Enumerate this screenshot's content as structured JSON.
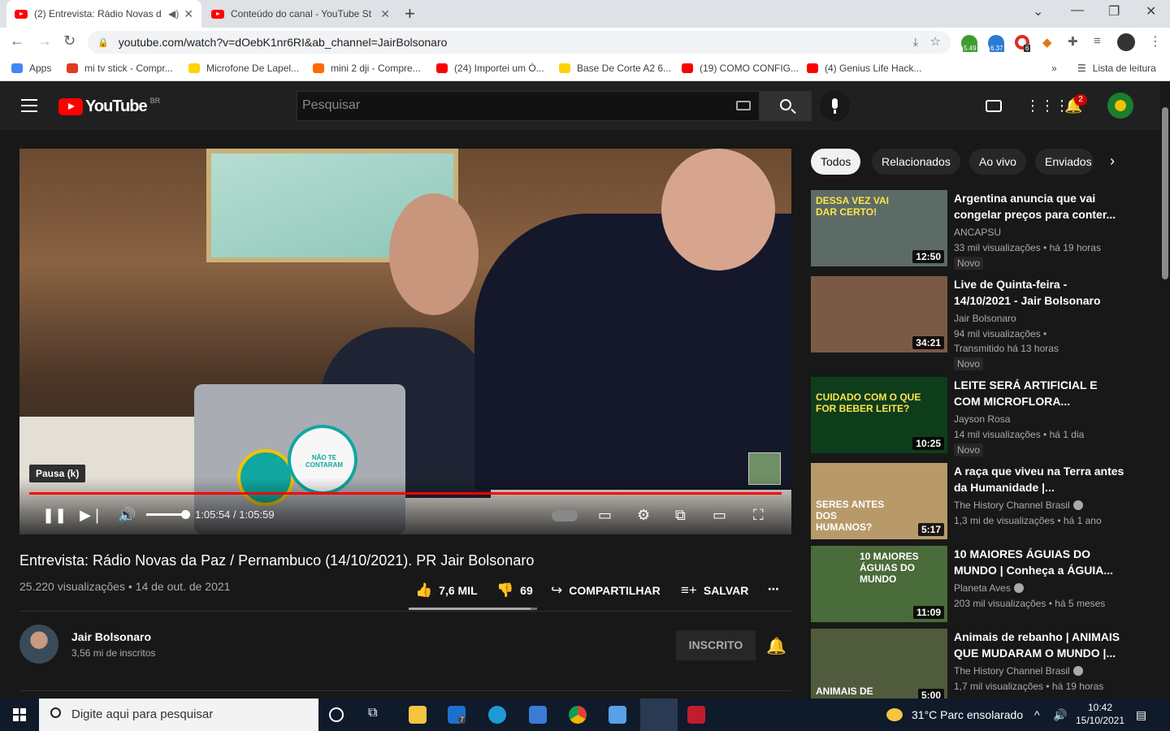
{
  "browser": {
    "tabs": [
      {
        "title": "(2) Entrevista: Rádio Novas d",
        "active": true
      },
      {
        "title": "Conteúdo do canal - YouTube St",
        "active": false
      }
    ],
    "url": "youtube.com/watch?v=dOebK1nr6RI&ab_channel=JairBolsonaro",
    "extensions": [
      {
        "name": "android-extension-icon",
        "badge": "5.49",
        "color": "#3c9d2e"
      },
      {
        "name": "cloud-extension-icon",
        "badge": "6.37",
        "color": "#2b7bd4"
      },
      {
        "name": "red-extension-icon",
        "badge": "6",
        "color": "#d93025"
      }
    ],
    "bookmarks": [
      {
        "label": "Apps",
        "icon_color": "#4285f4"
      },
      {
        "label": "mi tv stick - Compr...",
        "icon_color": "#e03a1e"
      },
      {
        "label": "Microfone De Lapel...",
        "icon_color": "#ffd200"
      },
      {
        "label": "mini 2 dji - Compre...",
        "icon_color": "#ff6a00"
      },
      {
        "label": "(24) Importei um Ó...",
        "icon_color": "#ff0000"
      },
      {
        "label": "Base De Corte A2 6...",
        "icon_color": "#ffd200"
      },
      {
        "label": "(19) COMO CONFIG...",
        "icon_color": "#ff0000"
      },
      {
        "label": "(4) Genius Life Hack...",
        "icon_color": "#ff0000"
      }
    ],
    "bookmarks_overflow": "»",
    "reading_list": "Lista de leitura"
  },
  "youtube": {
    "logo": "YouTube",
    "country": "BR",
    "search_placeholder": "Pesquisar",
    "notifications": "2",
    "player": {
      "tooltip": "Pausa (k)",
      "time": "1:05:54 / 1:05:59",
      "progress_fraction": 0.998
    },
    "video": {
      "title": "Entrevista: Rádio Novas da Paz / Pernambuco (14/10/2021). PR Jair Bolsonaro",
      "views_date": "25.220 visualizações • 14 de out. de 2021",
      "likes": "7,6 MIL",
      "dislikes": "69",
      "share": "COMPARTILHAR",
      "save": "SALVAR",
      "sticker_text": "NÃO TE CONTARAM"
    },
    "channel": {
      "name": "Jair Bolsonaro",
      "subs": "3,56 mi de inscritos",
      "subscribed": "INSCRITO"
    },
    "chips": [
      "Todos",
      "Relacionados",
      "Ao vivo",
      "Enviados"
    ],
    "recommendations": [
      {
        "title": "Argentina anuncia que vai congelar preços para conter...",
        "channel": "ANCAPSU",
        "meta1": "33 mil visualizações • há 19 horas",
        "meta2": "",
        "duration": "12:50",
        "thumb_text": "DESSA VEZ VAI DAR CERTO!",
        "verified": false,
        "novo": "Novo",
        "thumb_color": "#5d6b66"
      },
      {
        "title": "Live de Quinta-feira - 14/10/2021 - Jair Bolsonaro",
        "channel": "Jair Bolsonaro",
        "meta1": "94 mil visualizações •",
        "meta2": "Transmitido há 13 horas",
        "duration": "34:21",
        "thumb_text": "",
        "verified": false,
        "novo": "Novo",
        "thumb_color": "#7a5a45"
      },
      {
        "title": "LEITE SERÁ ARTIFICIAL E COM MICROFLORA...",
        "channel": "Jayson Rosa",
        "meta1": "14 mil visualizações • há 1 dia",
        "meta2": "",
        "duration": "10:25",
        "thumb_text": "CUIDADO COM O QUE FOR BEBER LEITE?",
        "verified": false,
        "novo": "Novo",
        "thumb_color": "#0e3d1c"
      },
      {
        "title": "A raça que viveu na Terra antes da Humanidade |...",
        "channel": "The History Channel Brasil",
        "meta1": "1,3 mi de visualizações • há 1 ano",
        "meta2": "",
        "duration": "5:17",
        "thumb_text": "SERES ANTES DOS HUMANOS?",
        "verified": true,
        "novo": "",
        "thumb_color": "#b89a6a"
      },
      {
        "title": "10 MAIORES ÁGUIAS DO MUNDO | Conheça a ÁGUIA...",
        "channel": "Planeta Aves",
        "meta1": "203 mil visualizações • há 5 meses",
        "meta2": "",
        "duration": "11:09",
        "thumb_text": "10 MAIORES ÁGUIAS DO MUNDO",
        "verified": true,
        "novo": "",
        "thumb_color": "#4a6b3a"
      },
      {
        "title": "Animais de rebanho | ANIMAIS QUE MUDARAM O MUNDO |...",
        "channel": "The History Channel Brasil",
        "meta1": "1,7 mil visualizações • há 19 horas",
        "meta2": "",
        "duration": "5:00",
        "thumb_text": "ANIMAIS DE REBANHO",
        "verified": true,
        "novo": "",
        "thumb_color": "#4f5b3c"
      }
    ]
  },
  "taskbar": {
    "search_placeholder": "Digite aqui para pesquisar",
    "weather": "31°C  Parc ensolarado",
    "time": "10:42",
    "date": "15/10/2021",
    "mail_badge": "7"
  }
}
